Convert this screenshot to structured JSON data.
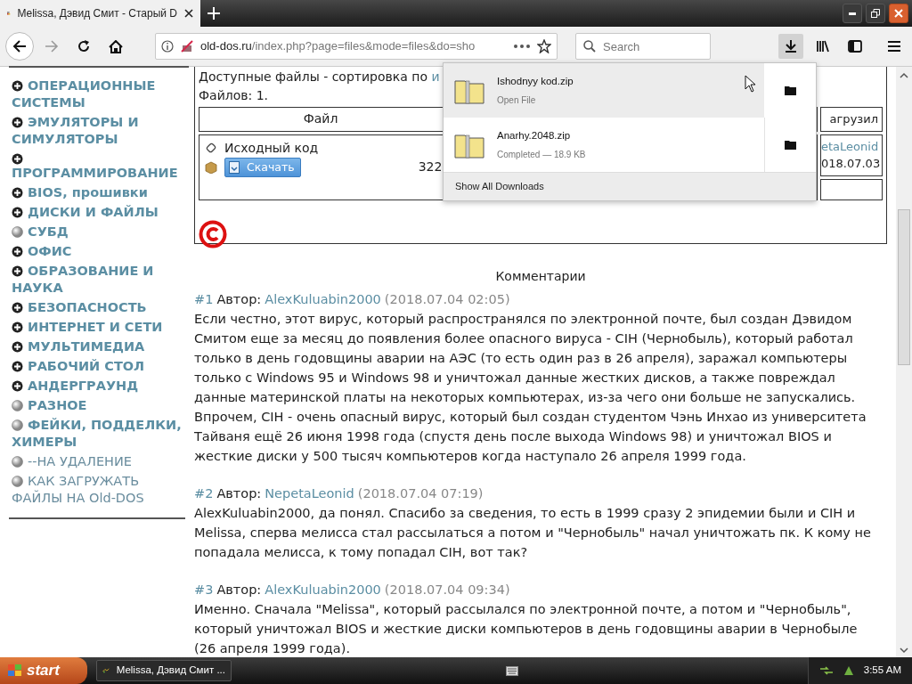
{
  "browser": {
    "tab": {
      "title": "Melissa, Дэвид Смит - Старый D",
      "selected": true
    },
    "url": {
      "host": "old-dos.ru",
      "path": "/index.php?page=files&mode=files&do=sho"
    },
    "search": {
      "placeholder": "Search"
    },
    "toolbar": [
      {
        "kind": "downloads",
        "active": true
      },
      {
        "kind": "library",
        "active": false
      },
      {
        "kind": "sidebar",
        "active": false
      },
      {
        "kind": "menu",
        "active": false
      }
    ]
  },
  "sidebar": [
    {
      "label": "ОПЕРАЦИОННЫЕ СИСТЕМЫ",
      "kind": "plus",
      "bold": true
    },
    {
      "label": "ЭМУЛЯТОРЫ И СИМУЛЯТОРЫ",
      "kind": "plus",
      "bold": true
    },
    {
      "label": "ПРОГРАММИРОВАНИЕ",
      "kind": "plus",
      "bold": true
    },
    {
      "label": "BIOS, прошивки",
      "kind": "plus",
      "bold": true
    },
    {
      "label": "ДИСКИ И ФАЙЛЫ",
      "kind": "plus",
      "bold": true
    },
    {
      "label": "СУБД",
      "kind": "dot",
      "bold": true
    },
    {
      "label": "ОФИС",
      "kind": "plus",
      "bold": true
    },
    {
      "label": "ОБРАЗОВАНИЕ И НАУКА",
      "kind": "plus",
      "bold": true
    },
    {
      "label": "БЕЗОПАСНОСТЬ",
      "kind": "plus",
      "bold": true
    },
    {
      "label": "ИНТЕРНЕТ И СЕТИ",
      "kind": "plus",
      "bold": true
    },
    {
      "label": "МУЛЬТИМЕДИА",
      "kind": "plus",
      "bold": true
    },
    {
      "label": "РАБОЧИЙ СТОЛ",
      "kind": "plus",
      "bold": true
    },
    {
      "label": "АНДЕРГРАУНД",
      "kind": "plus",
      "bold": true
    },
    {
      "label": "РАЗНОЕ",
      "kind": "dot",
      "bold": true
    },
    {
      "label": "ФЕЙКИ, ПОДДЕЛКИ, ХИМЕРЫ",
      "kind": "dot",
      "bold": true
    },
    {
      "label": "--НА УДАЛЕНИЕ",
      "kind": "dot",
      "bold": false
    },
    {
      "label": "КАК ЗАГРУЖАТЬ ФАЙЛЫ НА Old-DOS",
      "kind": "dot",
      "bold": false
    }
  ],
  "files": {
    "sort_label": "Доступные файлы - сортировка по",
    "sort_link": "и",
    "count": "Файлов: 1.",
    "columns": [
      "Файл",
      "агрузил"
    ],
    "rows": [
      {
        "name": "Исходный код",
        "button": "Скачать",
        "size": "322",
        "uploader": "etaLeonid",
        "date": "018.07.03"
      }
    ]
  },
  "comments": {
    "title": "Комментарии",
    "items": [
      {
        "number": "#1",
        "author_label": "Автор:",
        "author": "AlexKuluabin2000",
        "date": "(2018.07.04 02:05)",
        "text": "Если честно, этот вирус, который распространялся по электронной почте, был создан Дэвидом Смитом еще за месяц до появления более опасного вируса - CIH (Чернобыль), который работал только в день годовщины аварии на АЭС (то есть один раз в 26 апреля), заражал компьютеры только с Windows 95 и Windows 98 и уничтожал данные жестких дисков, а также повреждал данные материнской платы на некоторых компьютерах, из-за чего они больше не запускались. Впрочем, CIH - очень опасный вирус, который был создан студентом Чэнь Инхао из университета Тайваня ещё 26 июня 1998 года (спустя день после выхода Windows 98) и уничтожал BIOS и жесткие диски у 500 тысяч компьютеров когда наступало 26 апреля 1999 года."
      },
      {
        "number": "#2",
        "author_label": "Автор:",
        "author": "NepetaLeonid",
        "date": "(2018.07.04 07:19)",
        "text": "AlexKuluabin2000, да понял. Спасибо за сведения, то есть в 1999 сразу 2 эпидемии были и CIH и Melissa, сперва мелисса стал рассылаться а потом и \"Чернобыль\" начал уничтожать пк. К кому не попадала мелисса, к тому попадал CIH, вот так?"
      },
      {
        "number": "#3",
        "author_label": "Автор:",
        "author": "AlexKuluabin2000",
        "date": "(2018.07.04 09:34)",
        "text": "Именно. Сначала \"Melissa\", который рассылался по электронной почте, а потом и \"Чернобыль\", который уничтожал BIOS и жесткие диски компьютеров в день годовщины аварии в Чернобыле (26 апреля 1999 года)."
      }
    ]
  },
  "downloads_panel": {
    "items": [
      {
        "name": "Ishodnyy kod.zip",
        "status": "Open File",
        "hovered": true
      },
      {
        "name": "Anarhy.2048.zip",
        "status": "Completed — 18.9 KB",
        "hovered": false
      }
    ],
    "footer": "Show All Downloads"
  },
  "taskbar": {
    "start": "start",
    "task": "Melissa, Дэвид Смит ...",
    "time": "3:55 AM"
  }
}
